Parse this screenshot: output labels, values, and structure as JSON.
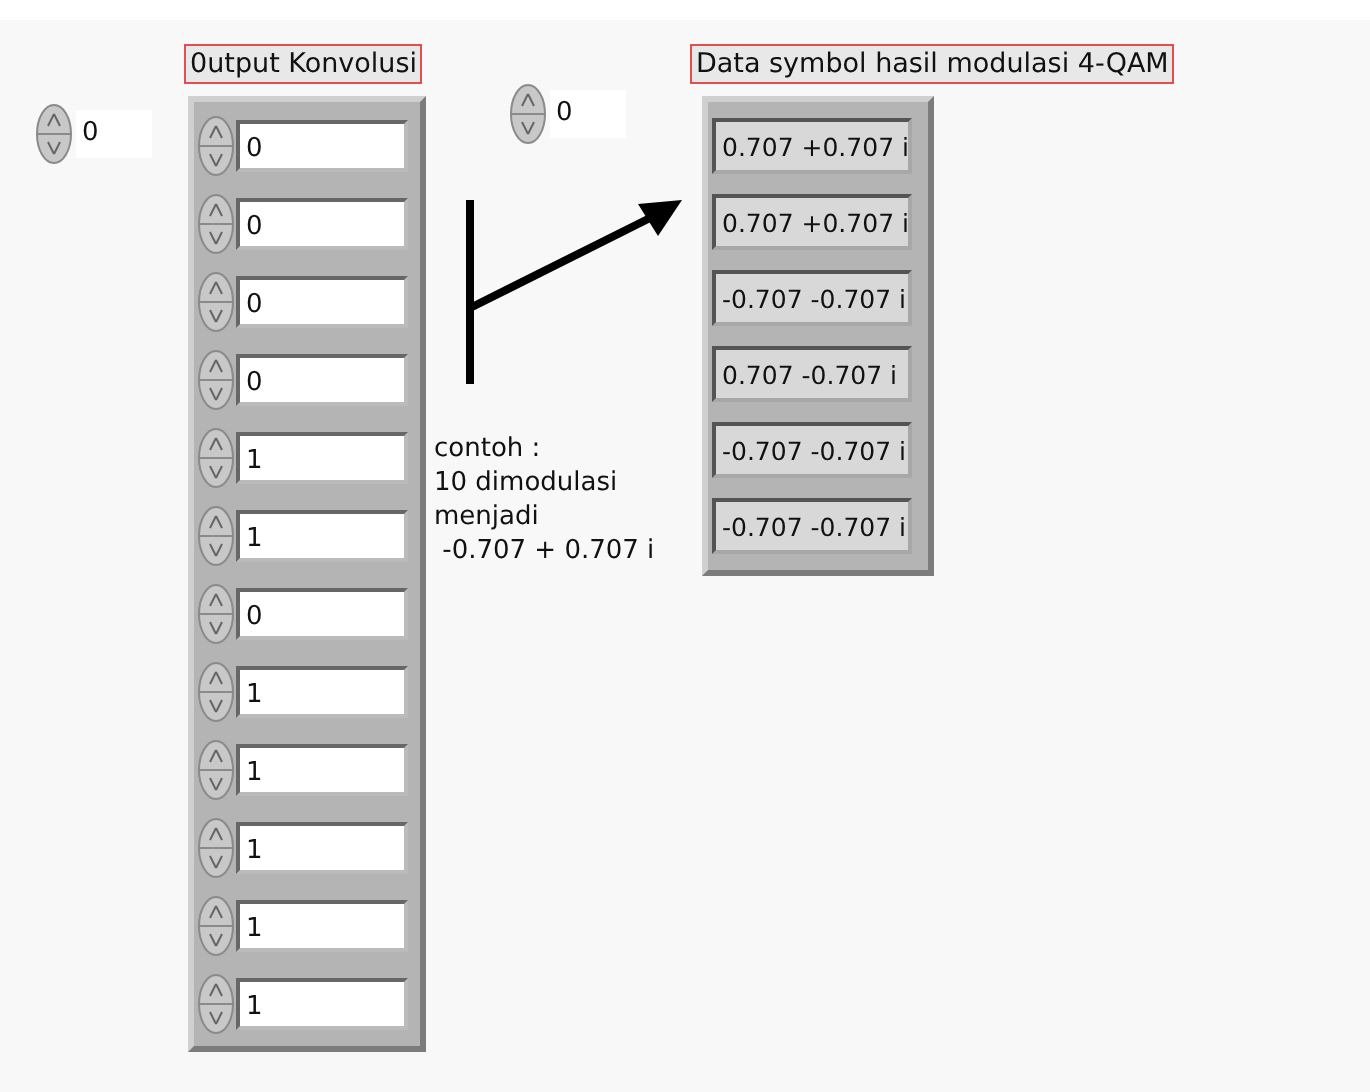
{
  "arrays": [
    {
      "kind": "control",
      "label": "0utput Konvolusi",
      "index": "0",
      "elements": [
        "0",
        "0",
        "0",
        "0",
        "1",
        "1",
        "0",
        "1",
        "1",
        "1",
        "1",
        "1"
      ]
    },
    {
      "kind": "indicator",
      "label": "Data symbol hasil modulasi 4-QAM",
      "index": "0",
      "elements": [
        "0.707 +0.707 i",
        "0.707 +0.707 i",
        "-0.707 -0.707 i",
        "0.707 -0.707 i",
        "-0.707 -0.707 i",
        "-0.707 -0.707 i"
      ]
    }
  ],
  "annotation": {
    "lines": [
      "contoh :",
      "10 dimodulasi",
      "menjadi",
      " -0.707 + 0.707 i"
    ]
  }
}
